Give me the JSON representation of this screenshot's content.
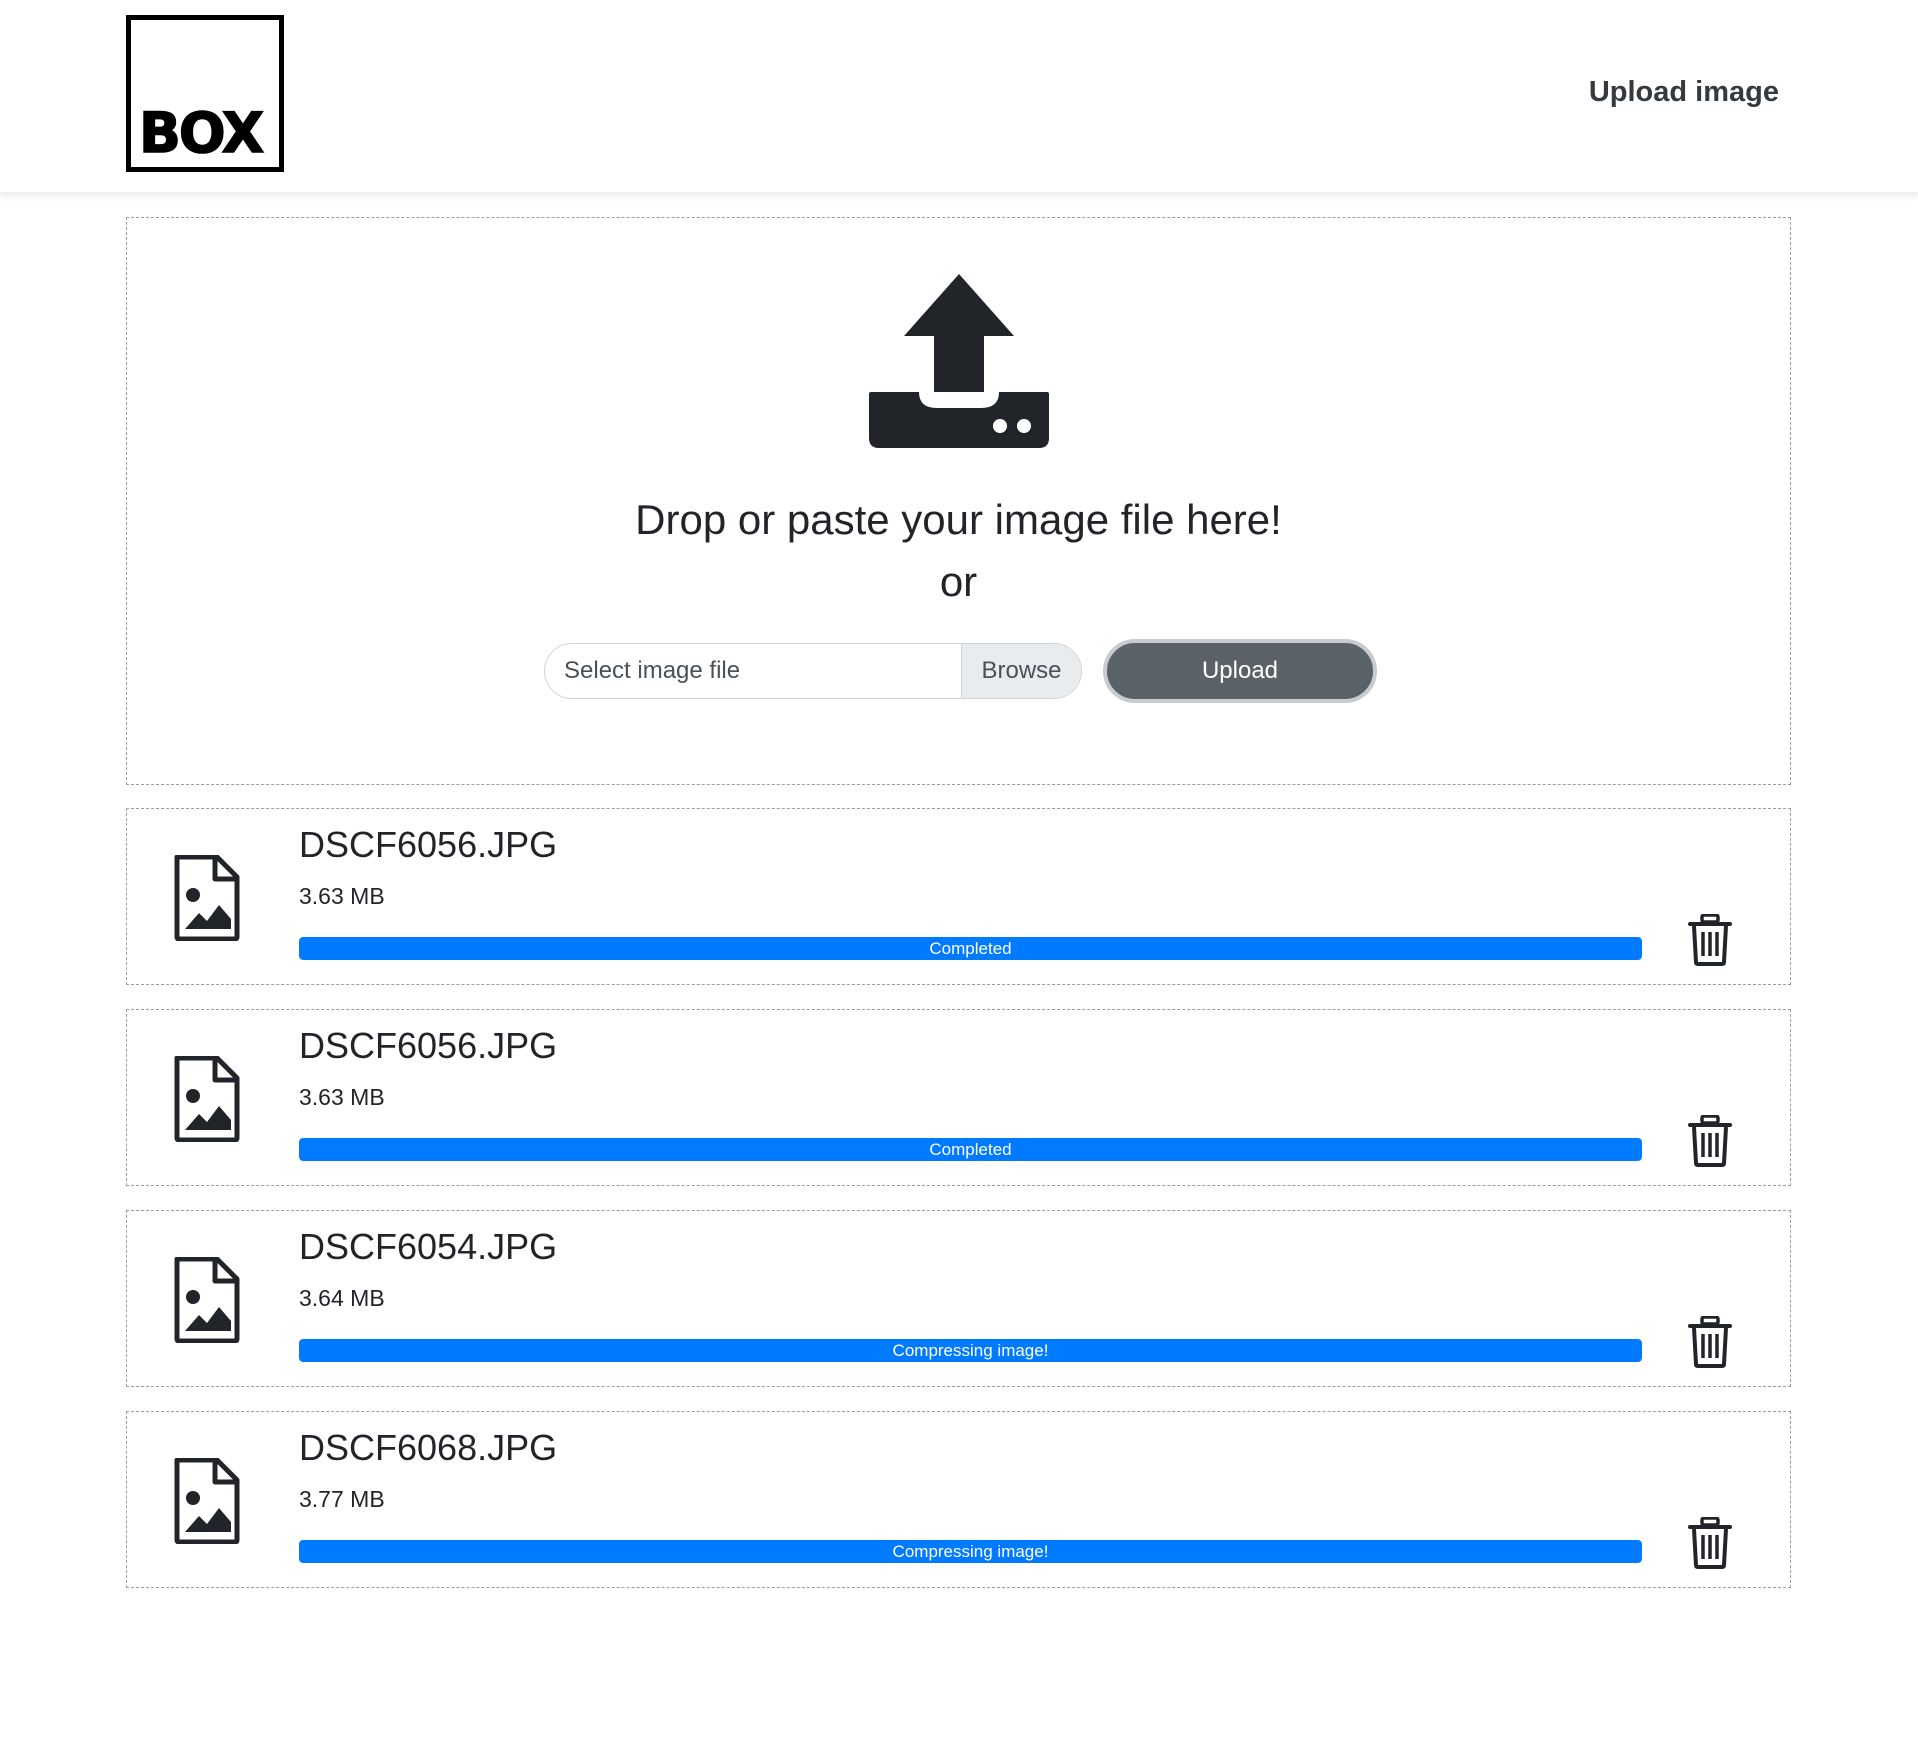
{
  "header": {
    "logo_text": "BOX",
    "nav_link": "Upload image"
  },
  "dropzone": {
    "icon": "upload-icon",
    "drop_text": "Drop or paste your image file here!",
    "or_text": "or",
    "file_input_placeholder": "Select image file",
    "browse_label": "Browse",
    "upload_label": "Upload"
  },
  "files": [
    {
      "name": "DSCF6056.JPG",
      "size": "3.63 MB",
      "status": "Completed",
      "progress": 100
    },
    {
      "name": "DSCF6056.JPG",
      "size": "3.63 MB",
      "status": "Completed",
      "progress": 100
    },
    {
      "name": "DSCF6054.JPG",
      "size": "3.64 MB",
      "status": "Compressing image!",
      "progress": 100
    },
    {
      "name": "DSCF6068.JPG",
      "size": "3.77 MB",
      "status": "Compressing image!",
      "progress": 100
    }
  ],
  "colors": {
    "progress": "#007bff",
    "upload_button": "#5a6268",
    "text": "#212529"
  }
}
